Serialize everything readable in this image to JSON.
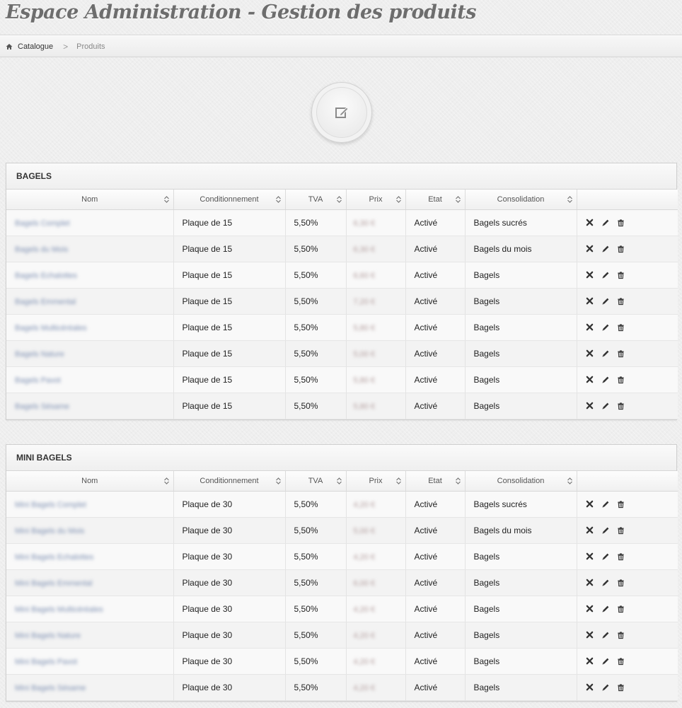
{
  "header": {
    "title": "Espace Administration - Gestion des produits"
  },
  "breadcrumb": {
    "home_label": "Catalogue",
    "current": "Produits",
    "home_icon": "home-icon",
    "separator": ">"
  },
  "edit_button": {
    "icon": "edit-icon"
  },
  "columns": [
    "Nom",
    "Conditionnement",
    "TVA",
    "Prix",
    "Etat",
    "Consolidation",
    ""
  ],
  "sections": [
    {
      "title": "BAGELS",
      "rows": [
        {
          "nom": "Bagels Complet",
          "cond": "Plaque de 15",
          "tva": "5,50%",
          "prix": "6,30 €",
          "etat": "Activé",
          "conso": "Bagels sucrés"
        },
        {
          "nom": "Bagels du Mois",
          "cond": "Plaque de 15",
          "tva": "5,50%",
          "prix": "6,30 €",
          "etat": "Activé",
          "conso": "Bagels du mois"
        },
        {
          "nom": "Bagels Echalottes",
          "cond": "Plaque de 15",
          "tva": "5,50%",
          "prix": "6,60 €",
          "etat": "Activé",
          "conso": "Bagels"
        },
        {
          "nom": "Bagels Emmental",
          "cond": "Plaque de 15",
          "tva": "5,50%",
          "prix": "7,20 €",
          "etat": "Activé",
          "conso": "Bagels"
        },
        {
          "nom": "Bagels Multicéréales",
          "cond": "Plaque de 15",
          "tva": "5,50%",
          "prix": "5,80 €",
          "etat": "Activé",
          "conso": "Bagels"
        },
        {
          "nom": "Bagels Nature",
          "cond": "Plaque de 15",
          "tva": "5,50%",
          "prix": "5,00 €",
          "etat": "Activé",
          "conso": "Bagels"
        },
        {
          "nom": "Bagels Pavot",
          "cond": "Plaque de 15",
          "tva": "5,50%",
          "prix": "5,80 €",
          "etat": "Activé",
          "conso": "Bagels"
        },
        {
          "nom": "Bagels Sésame",
          "cond": "Plaque de 15",
          "tva": "5,50%",
          "prix": "5,80 €",
          "etat": "Activé",
          "conso": "Bagels"
        }
      ]
    },
    {
      "title": "MINI BAGELS",
      "rows": [
        {
          "nom": "Mini Bagels Complet",
          "cond": "Plaque de 30",
          "tva": "5,50%",
          "prix": "4,20 €",
          "etat": "Activé",
          "conso": "Bagels sucrés"
        },
        {
          "nom": "Mini Bagels du Mois",
          "cond": "Plaque de 30",
          "tva": "5,50%",
          "prix": "5,00 €",
          "etat": "Activé",
          "conso": "Bagels du mois"
        },
        {
          "nom": "Mini Bagels Echalottes",
          "cond": "Plaque de 30",
          "tva": "5,50%",
          "prix": "4,20 €",
          "etat": "Activé",
          "conso": "Bagels"
        },
        {
          "nom": "Mini Bagels Emmental",
          "cond": "Plaque de 30",
          "tva": "5,50%",
          "prix": "6,00 €",
          "etat": "Activé",
          "conso": "Bagels"
        },
        {
          "nom": "Mini Bagels Multicéréales",
          "cond": "Plaque de 30",
          "tva": "5,50%",
          "prix": "4,20 €",
          "etat": "Activé",
          "conso": "Bagels"
        },
        {
          "nom": "Mini Bagels Nature",
          "cond": "Plaque de 30",
          "tva": "5,50%",
          "prix": "4,20 €",
          "etat": "Activé",
          "conso": "Bagels"
        },
        {
          "nom": "Mini Bagels Pavot",
          "cond": "Plaque de 30",
          "tva": "5,50%",
          "prix": "4,20 €",
          "etat": "Activé",
          "conso": "Bagels"
        },
        {
          "nom": "Mini Bagels Sésame",
          "cond": "Plaque de 30",
          "tva": "5,50%",
          "prix": "4,20 €",
          "etat": "Activé",
          "conso": "Bagels"
        }
      ]
    }
  ],
  "row_actions": [
    "delete-icon",
    "edit-pencil-icon",
    "trash-icon"
  ]
}
